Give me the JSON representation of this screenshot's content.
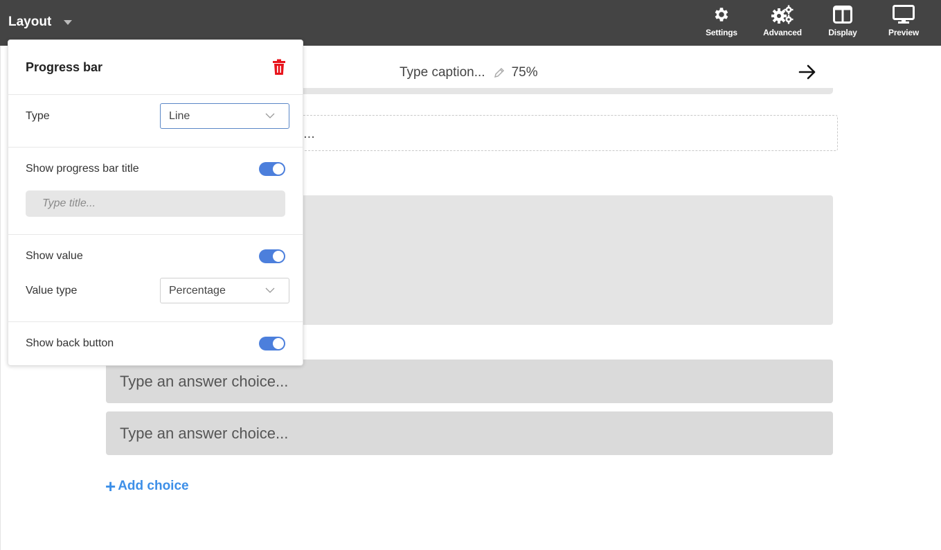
{
  "topbar": {
    "layout_label": "Layout",
    "tools": [
      {
        "label": "Settings",
        "icon": "gear-icon"
      },
      {
        "label": "Advanced",
        "icon": "gears-icon"
      },
      {
        "label": "Display",
        "icon": "columns-icon"
      },
      {
        "label": "Preview",
        "icon": "monitor-icon"
      }
    ]
  },
  "canvas": {
    "caption": "Type caption...",
    "progress_value": "75%",
    "progress_fraction": 0.75,
    "question_placeholder": "?...",
    "choices": [
      "Type an answer choice...",
      "Type an answer choice..."
    ],
    "add_choice_label": "Add choice",
    "accent_color": "#3d8fe8"
  },
  "panel": {
    "title": "Progress bar",
    "type_label": "Type",
    "type_value": "Line",
    "show_title_label": "Show progress bar title",
    "show_title_on": true,
    "title_placeholder": "Type title...",
    "show_value_label": "Show value",
    "show_value_on": true,
    "value_type_label": "Value type",
    "value_type_value": "Percentage",
    "show_back_label": "Show back button",
    "show_back_on": true,
    "toggle_color": "#4c7fdc",
    "delete_color": "#e8141c"
  }
}
